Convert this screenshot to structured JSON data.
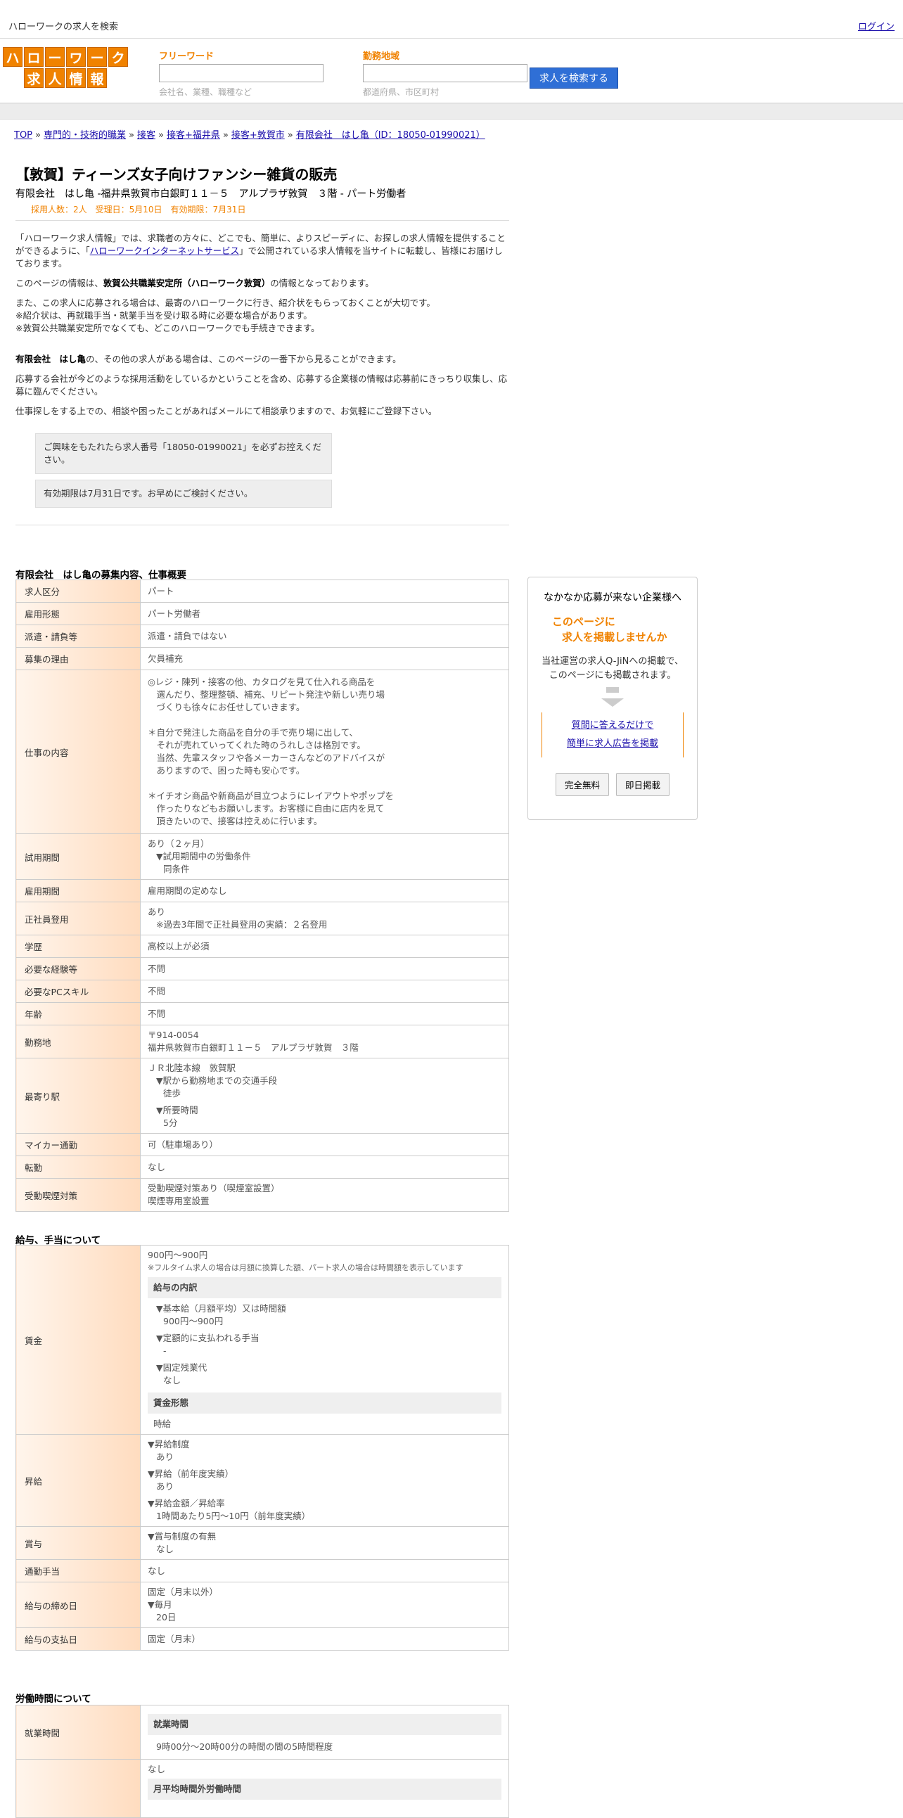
{
  "topbar": {
    "site_title": "ハローワークの求人を検索",
    "login": "ログイン"
  },
  "logo": {
    "row1": [
      "ハ",
      "ロ",
      "ー",
      "ワ",
      "ー",
      "ク"
    ],
    "row2": [
      "求",
      "人",
      "情",
      "報"
    ]
  },
  "search": {
    "freeword_label": "フリーワード",
    "freeword_hint": "会社名、業種、職種など",
    "area_label": "勤務地域",
    "area_hint": "都道府県、市区町村",
    "button": "求人を検索する"
  },
  "breadcrumb": [
    "TOP",
    "専門的・技術的職業",
    "接客",
    "接客+福井県",
    "接客+敦賀市",
    "有限会社　はし亀（ID：18050-01990021）"
  ],
  "job": {
    "title": "【敦賀】ティーンズ女子向けファンシー雑貨の販売",
    "subtitle": "有限会社　はし亀 -福井県敦賀市白銀町１１－５　アルプラザ敦賀　３階 - パート労働者",
    "meta": "採用人数：2人　受理日：5月10日　有効期限：7月31日"
  },
  "intro": {
    "p1a": "「ハローワーク求人情報」では、求職者の方々に、どこでも、簡単に、よりスピーディに、お探しの求人情報を提供することができるように、「",
    "p1link": "ハローワークインターネットサービス",
    "p1b": "」で公開されている求人情報を当サイトに転載し、皆様にお届けしております。",
    "p2a": "このページの情報は、",
    "p2b": "敦賀公共職業安定所（ハローワーク敦賀）",
    "p2c": "の情報となっております。",
    "p3_1": "また、この求人に応募される場合は、最寄のハローワークに行き、紹介状をもらっておくことが大切です。",
    "p3_2": "※紹介状は、再就職手当・就業手当を受け取る時に必要な場合があります。",
    "p3_3": "※敦賀公共職業安定所でなくても、どこのハローワークでも手続きできます。",
    "p4a": "有限会社　はし亀",
    "p4b": "の、その他の求人がある場合は、このページの一番下から見ることができます。",
    "p5": "応募する会社が今どのような採用活動をしているかということを含め、応募する企業様の情報は応募前にきっちり収集し、応募に臨んでください。",
    "p6": "仕事探しをする上での、相談や困ったことがあればメールにて相談承りますので、お気軽にご登録下さい。",
    "notice1": "ご興味をもたれたら求人番号「18050-01990021」を必ずお控えください。",
    "notice2": "有効期限は7月31日です。お早めにご検討ください。"
  },
  "overview": {
    "title": "有限会社　はし亀の募集内容、仕事概要",
    "rows": [
      {
        "k": "求人区分",
        "v": "パート"
      },
      {
        "k": "雇用形態",
        "v": "パート労働者"
      },
      {
        "k": "派遣・請負等",
        "v": "派遣・請負ではない"
      },
      {
        "k": "募集の理由",
        "v": "欠員補充"
      }
    ],
    "work_key": "仕事の内容",
    "work_lines": [
      "◎レジ・陳列・接客の他、カタログを見て仕入れる商品を",
      "　選んだり、整理整頓、補充、リピート発注や新しい売り場",
      "　づくりも徐々にお任せしていきます。",
      "",
      "＊自分で発注した商品を自分の手で売り場に出して、",
      "　それが売れていってくれた時のうれしさは格別です。",
      "　当然、先輩スタッフや各メーカーさんなどのアドバイスが",
      "　ありますので、困った時も安心です。",
      "",
      "＊イチオシ商品や新商品が目立つようにレイアウトやポップを",
      "　作ったりなどもお願いします。お客様に自由に店内を見て",
      "　頂きたいので、接客は控えめに行います。"
    ],
    "trial_key": "試用期間",
    "trial_v": "あり（２ヶ月）",
    "trial_sub": "▼試用期間中の労働条件",
    "trial_sub2": "同条件",
    "period_key": "雇用期間",
    "period_v": "雇用期間の定めなし",
    "regular_key": "正社員登用",
    "regular_v": "あり",
    "regular_sub": "※過去3年間で正社員登用の実績：２名登用",
    "rows2": [
      {
        "k": "学歴",
        "v": "高校以上が必須"
      },
      {
        "k": "必要な経験等",
        "v": "不問"
      },
      {
        "k": "必要なPCスキル",
        "v": "不問"
      },
      {
        "k": "年齢",
        "v": "不問"
      }
    ],
    "place_key": "勤務地",
    "place_zip": "〒914-0054",
    "place_addr": "福井県敦賀市白銀町１１－５　アルプラザ敦賀　３階",
    "station_key": "最寄り駅",
    "station_v": "ＪＲ北陸本線　敦賀駅",
    "station_s1": "▼駅から勤務地までの交通手段",
    "station_s1v": "徒歩",
    "station_s2": "▼所要時間",
    "station_s2v": "5分",
    "rows3": [
      {
        "k": "マイカー通勤",
        "v": "可（駐車場あり）"
      },
      {
        "k": "転勤",
        "v": "なし"
      }
    ],
    "smoke_key": "受動喫煙対策",
    "smoke_v1": "受動喫煙対策あり（喫煙室設置）",
    "smoke_v2": "喫煙専用室設置"
  },
  "salary": {
    "title": "給与、手当について",
    "wage_key": "賃金",
    "wage_v": "900円〜900円",
    "wage_note": "※フルタイム求人の場合は月額に換算した額、パート求人の場合は時間額を表示しています",
    "breakdown_hd": "給与の内訳",
    "b1": "▼基本給（月額平均）又は時間額",
    "b1v": "900円〜900円",
    "b2": "▼定額的に支払われる手当",
    "b2v": "-",
    "b3": "▼固定残業代",
    "b3v": "なし",
    "form_hd": "賃金形態",
    "form_v": "時給",
    "raise_key": "昇給",
    "r1": "▼昇給制度",
    "r1v": "あり",
    "r2": "▼昇給（前年度実績）",
    "r2v": "あり",
    "r3": "▼昇給金額／昇給率",
    "r3v": "1時間あたり5円〜10円（前年度実績）",
    "bonus_key": "賞与",
    "bonus_s": "▼賞与制度の有無",
    "bonus_v": "なし",
    "commute_key": "通勤手当",
    "commute_v": "なし",
    "close_key": "給与の締め日",
    "close_v": "固定（月末以外）",
    "close_s": "▼毎月",
    "close_sv": "20日",
    "pay_key": "給与の支払日",
    "pay_v": "固定（月末）"
  },
  "hours": {
    "title": "労働時間について",
    "work_key": "就業時間",
    "work_hd": "就業時間",
    "work_v": "9時00分〜20時00分の時間の間の5時間程度",
    "over_v": "なし",
    "over_hd": "月平均時間外労働時間"
  },
  "ad": {
    "t1": "なかなか応募が来ない企業様へ",
    "t2a": "このページに",
    "t2b": "求人を掲載しませんか",
    "t3a": "当社運営の求人Q-JiNへの掲載で、",
    "t3b": "このページにも掲載されます。",
    "link1": "質問に答えるだけで",
    "link2": "簡単に求人広告を掲載",
    "btn1": "完全無料",
    "btn2": "即日掲載"
  }
}
